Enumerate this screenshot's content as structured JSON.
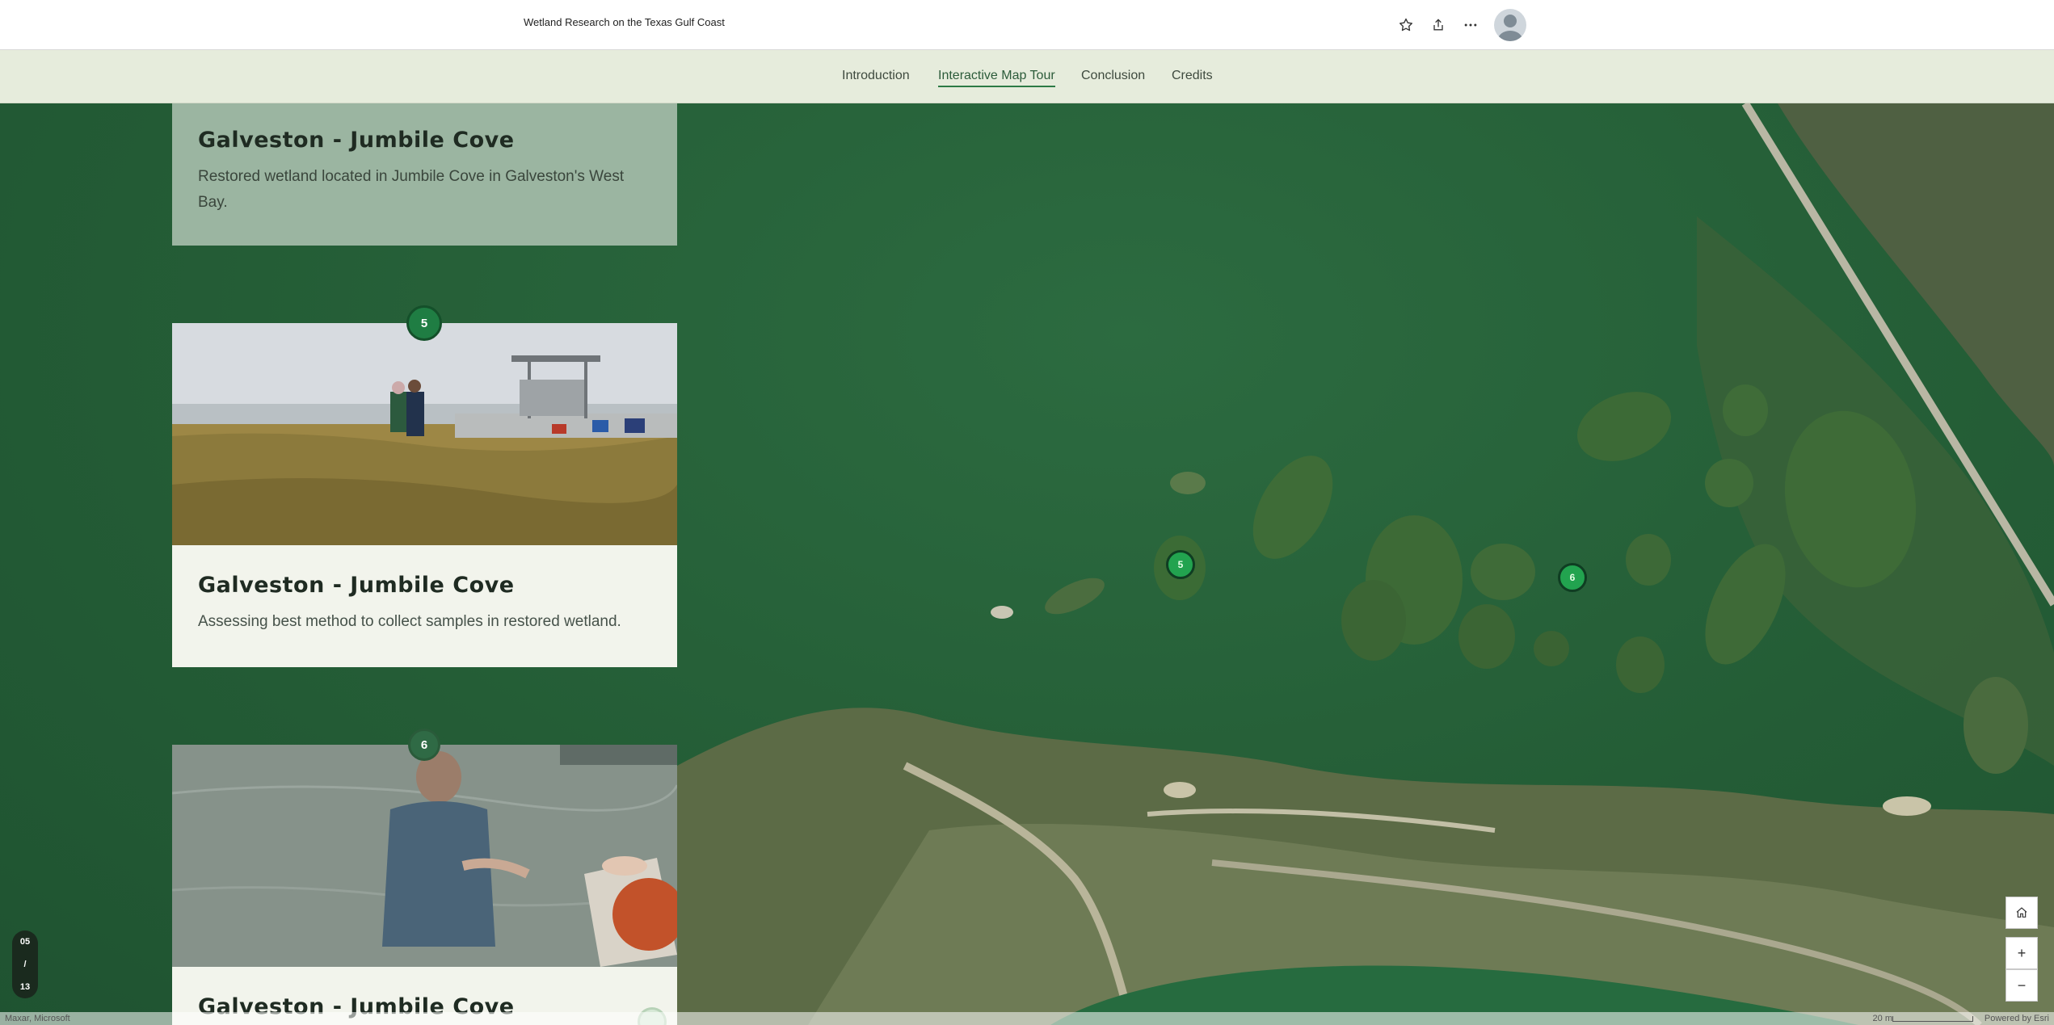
{
  "header": {
    "title": "Wetland Research on the Texas Gulf Coast",
    "favorite_icon": "star-icon",
    "share_icon": "share-icon",
    "more_icon": "more-icon",
    "avatar_icon": "user-avatar-icon"
  },
  "nav": {
    "items": [
      "Introduction",
      "Interactive Map Tour",
      "Conclusion",
      "Credits"
    ],
    "active": "Interactive Map Tour"
  },
  "cards": [
    {
      "title": "Galveston - Jumbile Cove",
      "description": "Restored wetland located in Jumbile Cove in Galveston's West Bay."
    },
    {
      "number": "5",
      "title": "Galveston - Jumbile Cove",
      "description": "Assessing best method to collect samples in restored wetland."
    },
    {
      "number": "6",
      "title": "Galveston - Jumbile Cove"
    }
  ],
  "map": {
    "markers": [
      "5",
      "6"
    ],
    "controls": {
      "home_icon": "home-icon",
      "zoom_in": "+",
      "zoom_out": "−"
    },
    "attribution_left": "Maxar, Microsoft",
    "scale_label": "20 m",
    "attribution_right": "Powered by Esri"
  },
  "counter": {
    "current": "05",
    "separator": "/",
    "total": "13"
  },
  "colors": {
    "accent": "#2d7a45",
    "marker": "#22a34f",
    "nav_bg": "#e6ecdc"
  }
}
